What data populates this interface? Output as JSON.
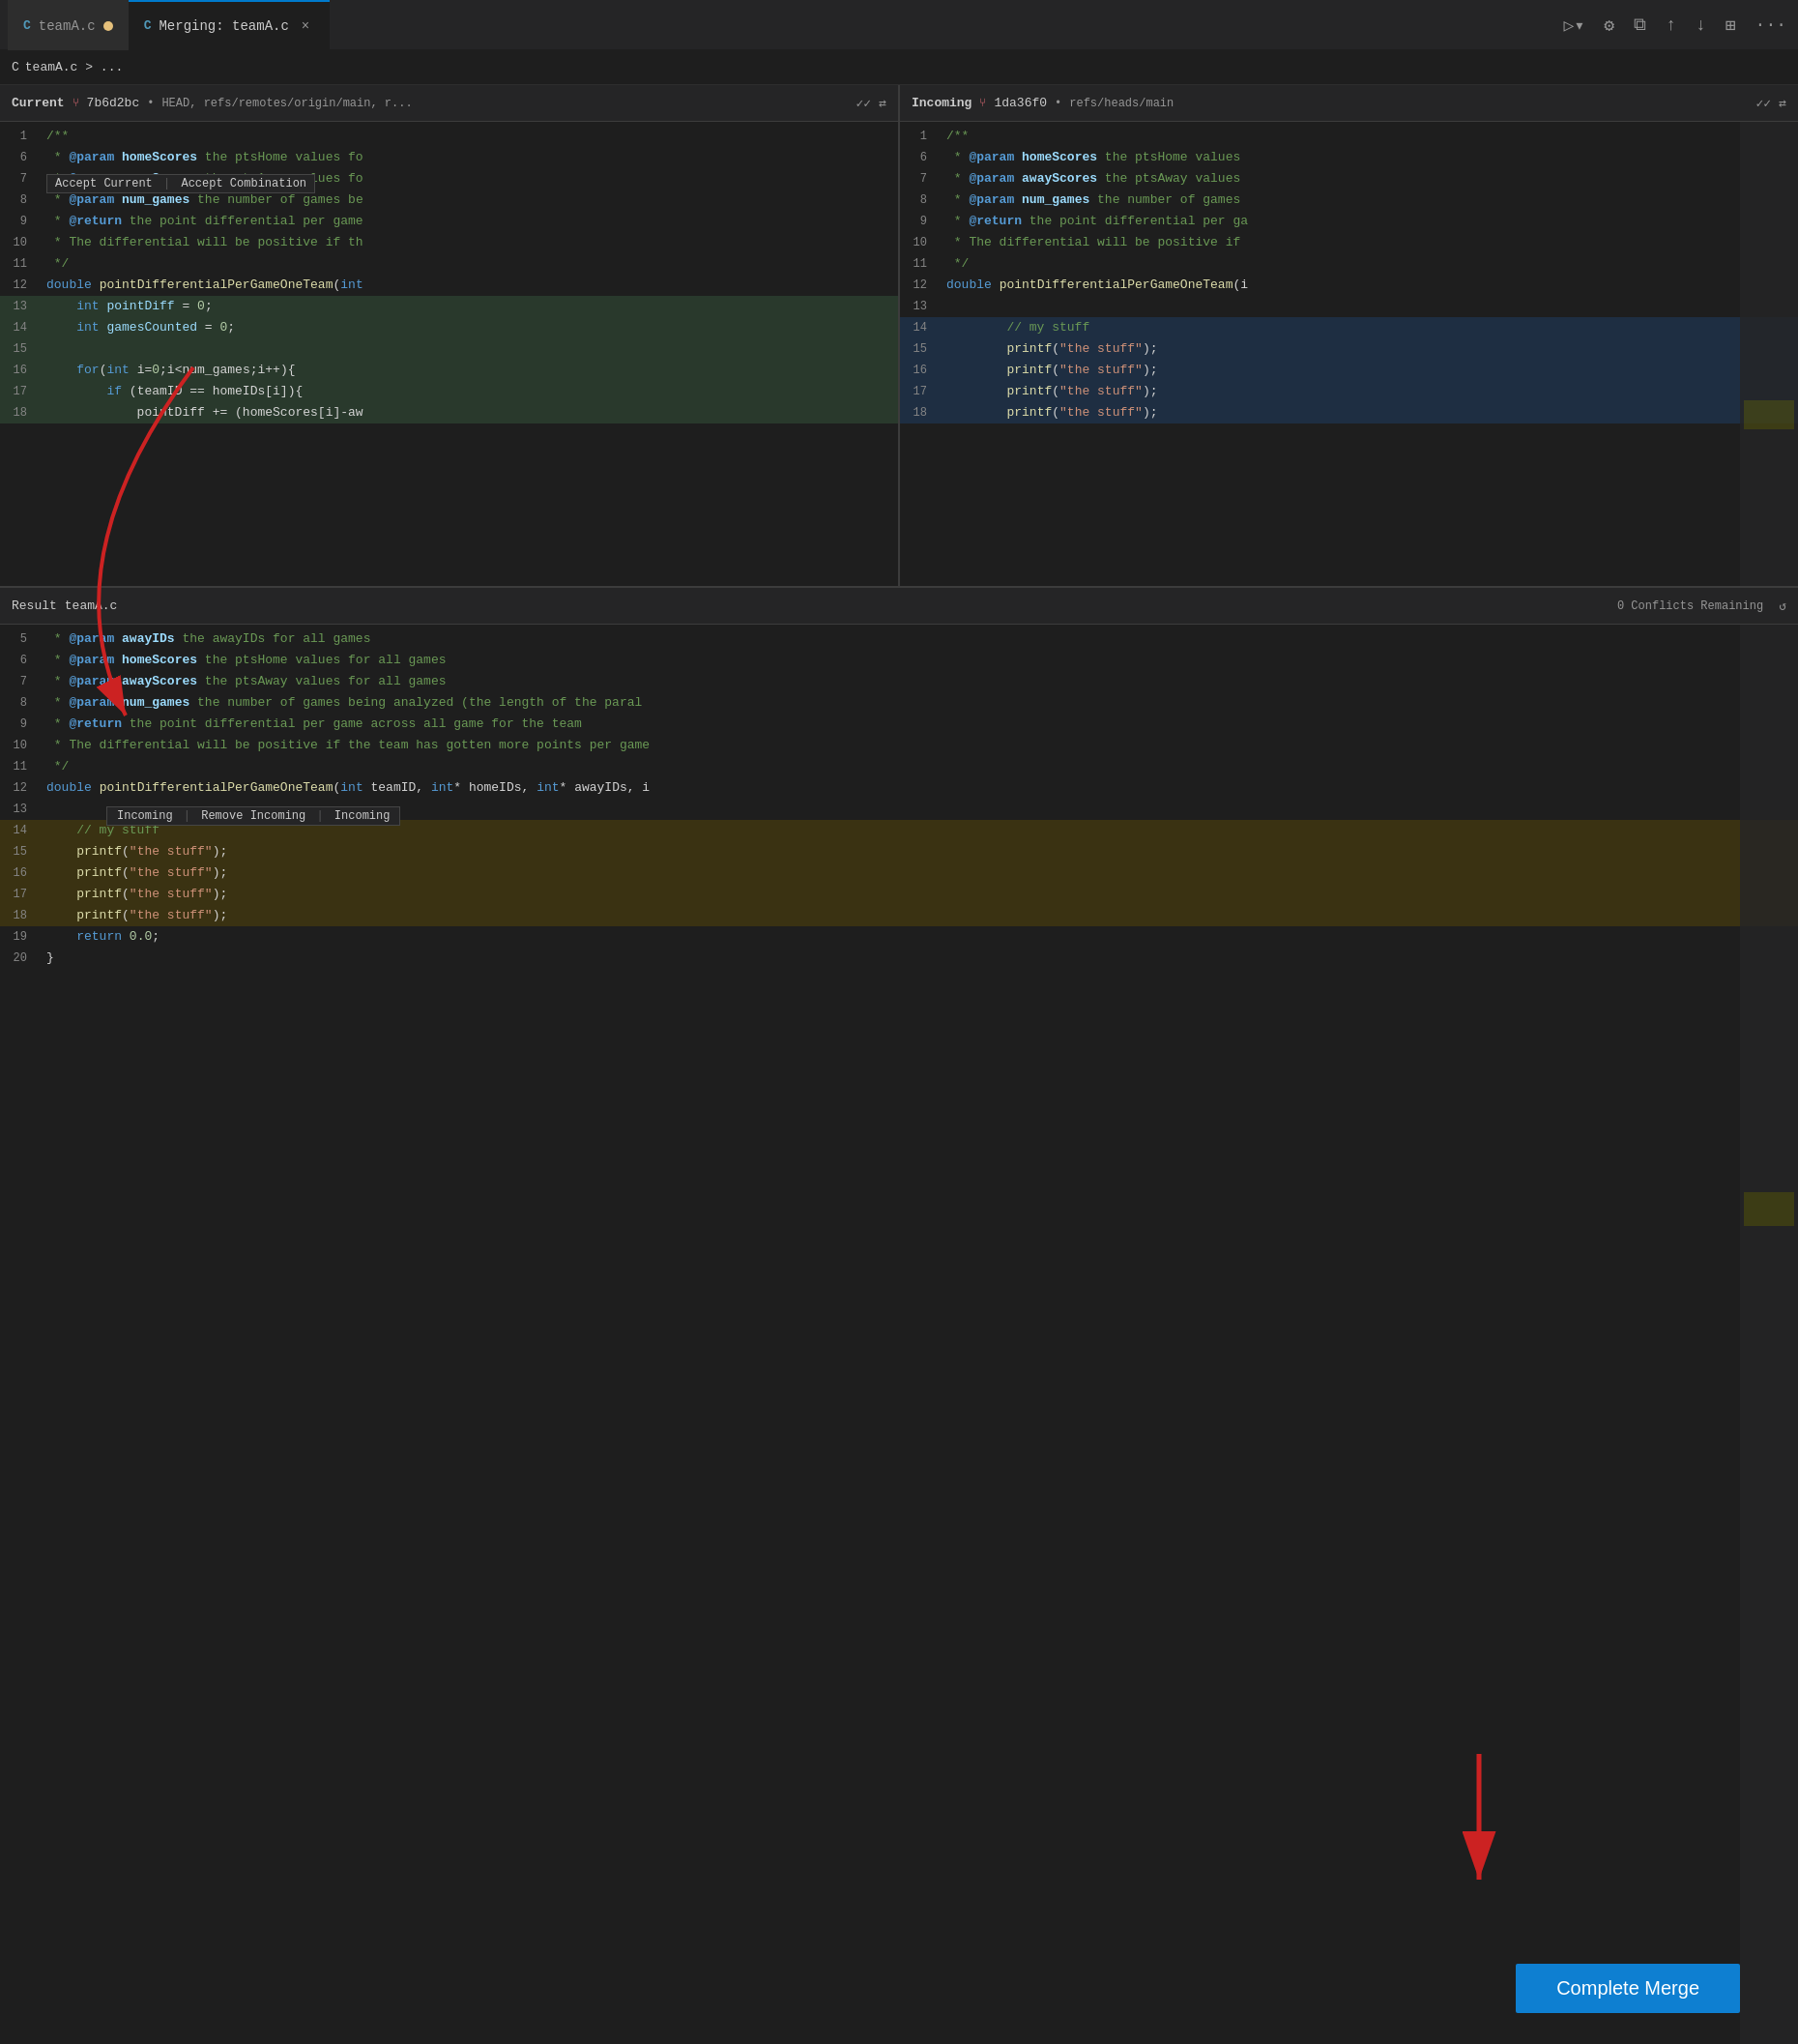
{
  "tabs": [
    {
      "id": "teamA",
      "label": "teamA.c",
      "icon": "C",
      "active": false,
      "modified": true
    },
    {
      "id": "merging",
      "label": "Merging: teamA.c",
      "icon": "C",
      "active": true,
      "modified": false,
      "closeable": true
    }
  ],
  "breadcrumb": {
    "icon": "C",
    "path": "teamA.c > ..."
  },
  "current_pane": {
    "label": "Current",
    "git_hash": "7b6d2bc",
    "git_refs": "HEAD, refs/remotes/origin/main, r...",
    "accept_bar": {
      "accept_current": "Accept Current",
      "sep": "|",
      "accept_combination": "Accept Combination"
    }
  },
  "incoming_pane": {
    "label": "Incoming",
    "git_hash": "1da36f0",
    "git_refs": "refs/heads/main"
  },
  "result_pane": {
    "label": "Result",
    "filename": "teamA.c",
    "conflicts_remaining": "0 Conflicts Remaining"
  },
  "current_lines": [
    {
      "num": 1,
      "content": "/**",
      "style": "comment"
    },
    {
      "num": 6,
      "content": " * @param homeScores the ptsHome values fo",
      "style": "param-line"
    },
    {
      "num": 7,
      "content": " * @param awayScores the ptsAway values fo",
      "style": "param-line"
    },
    {
      "num": 8,
      "content": " * @param num_games the number of games be",
      "style": "param-line"
    },
    {
      "num": 9,
      "content": " * @return the point differential per game",
      "style": "param-line"
    },
    {
      "num": 10,
      "content": " * The differential will be positive if th",
      "style": "comment-line"
    },
    {
      "num": 11,
      "content": " */",
      "style": "comment"
    },
    {
      "num": 12,
      "content": "double pointDifferentialPerGameOneTeam(int",
      "style": "fn-line"
    },
    {
      "num": 13,
      "content": "    int pointDiff = 0;",
      "style": "normal-added"
    },
    {
      "num": 14,
      "content": "    int gamesCounted = 0;",
      "style": "normal-added"
    },
    {
      "num": 15,
      "content": "",
      "style": "normal-added"
    },
    {
      "num": 16,
      "content": "    for(int i=0;i<num_games;i++){",
      "style": "normal-added"
    },
    {
      "num": 17,
      "content": "        if (teamID == homeIDs[i]){",
      "style": "normal-added"
    },
    {
      "num": 18,
      "content": "            pointDiff += (homeScores[i]-aw",
      "style": "normal-added"
    }
  ],
  "incoming_lines": [
    {
      "num": 1,
      "content": "/**",
      "style": "comment"
    },
    {
      "num": 6,
      "content": " * @param homeScores the ptsHome values",
      "style": "param-line"
    },
    {
      "num": 7,
      "content": " * @param awayScores the ptsAway values",
      "style": "param-line"
    },
    {
      "num": 8,
      "content": " * @param num_games the number of games",
      "style": "param-line"
    },
    {
      "num": 9,
      "content": " * @return the point differential per ga",
      "style": "param-line"
    },
    {
      "num": 10,
      "content": " * The differential will be positive if",
      "style": "comment-line"
    },
    {
      "num": 11,
      "content": " */",
      "style": "comment"
    },
    {
      "num": 12,
      "content": "double pointDifferentialPerGameOneTeam(i",
      "style": "fn-line"
    },
    {
      "num": 13,
      "content": "",
      "style": "incoming-gap"
    },
    {
      "num": 14,
      "content": "        // my stuff",
      "style": "incoming-highlight"
    },
    {
      "num": 15,
      "content": "        printf(\"the stuff\");",
      "style": "incoming-highlight"
    },
    {
      "num": 16,
      "content": "        printf(\"the stuff\");",
      "style": "incoming-highlight"
    },
    {
      "num": 17,
      "content": "        printf(\"the stuff\");",
      "style": "incoming-highlight"
    },
    {
      "num": 18,
      "content": "        printf(\"the stuff\");",
      "style": "incoming-highlight"
    }
  ],
  "result_lines": [
    {
      "num": 5,
      "content": " * @param awayIDs the awayIDs for all games",
      "style": "comment-line"
    },
    {
      "num": 6,
      "content": " * @param homeScores the ptsHome values for all games",
      "style": "comment-line"
    },
    {
      "num": 7,
      "content": " * @param awayScores the ptsAway values for all games",
      "style": "comment-line"
    },
    {
      "num": 8,
      "content": " * @param num_games the number of games being analyzed (the length of the paral",
      "style": "comment-line"
    },
    {
      "num": 9,
      "content": " * @return the point differential per game across all game for the team",
      "style": "comment-line"
    },
    {
      "num": 10,
      "content": " * The differential will be positive if the team has gotten more points per game",
      "style": "comment-line"
    },
    {
      "num": 11,
      "content": " */",
      "style": "comment"
    },
    {
      "num": 12,
      "content": "double pointDifferentialPerGameOneTeam(int teamID, int* homeIDs, int* awayIDs, i",
      "style": "fn-line"
    },
    {
      "num": 13,
      "content": "",
      "style": "normal"
    },
    {
      "num": 14,
      "content": "    // my stuff",
      "style": "incoming-result"
    },
    {
      "num": 15,
      "content": "    printf(\"the stuff\");",
      "style": "incoming-result"
    },
    {
      "num": 16,
      "content": "    printf(\"the stuff\");",
      "style": "incoming-result"
    },
    {
      "num": 17,
      "content": "    printf(\"the stuff\");",
      "style": "incoming-result"
    },
    {
      "num": 18,
      "content": "    printf(\"the stuff\");",
      "style": "incoming-result"
    },
    {
      "num": 19,
      "content": "    return 0.0;",
      "style": "normal"
    },
    {
      "num": 20,
      "content": "}",
      "style": "normal"
    }
  ],
  "inline_resolve": {
    "incoming": "Incoming",
    "sep": "|",
    "remove_incoming": "Remove Incoming",
    "incoming2": "Incoming"
  },
  "complete_merge": {
    "label": "Complete Merge"
  },
  "colors": {
    "accent": "#007acc",
    "added_bg": "rgba(88,166,99,0.2)",
    "incoming_bg": "rgba(72,118,214,0.25)",
    "conflict_bg": "rgba(100,80,0,0.4)"
  }
}
